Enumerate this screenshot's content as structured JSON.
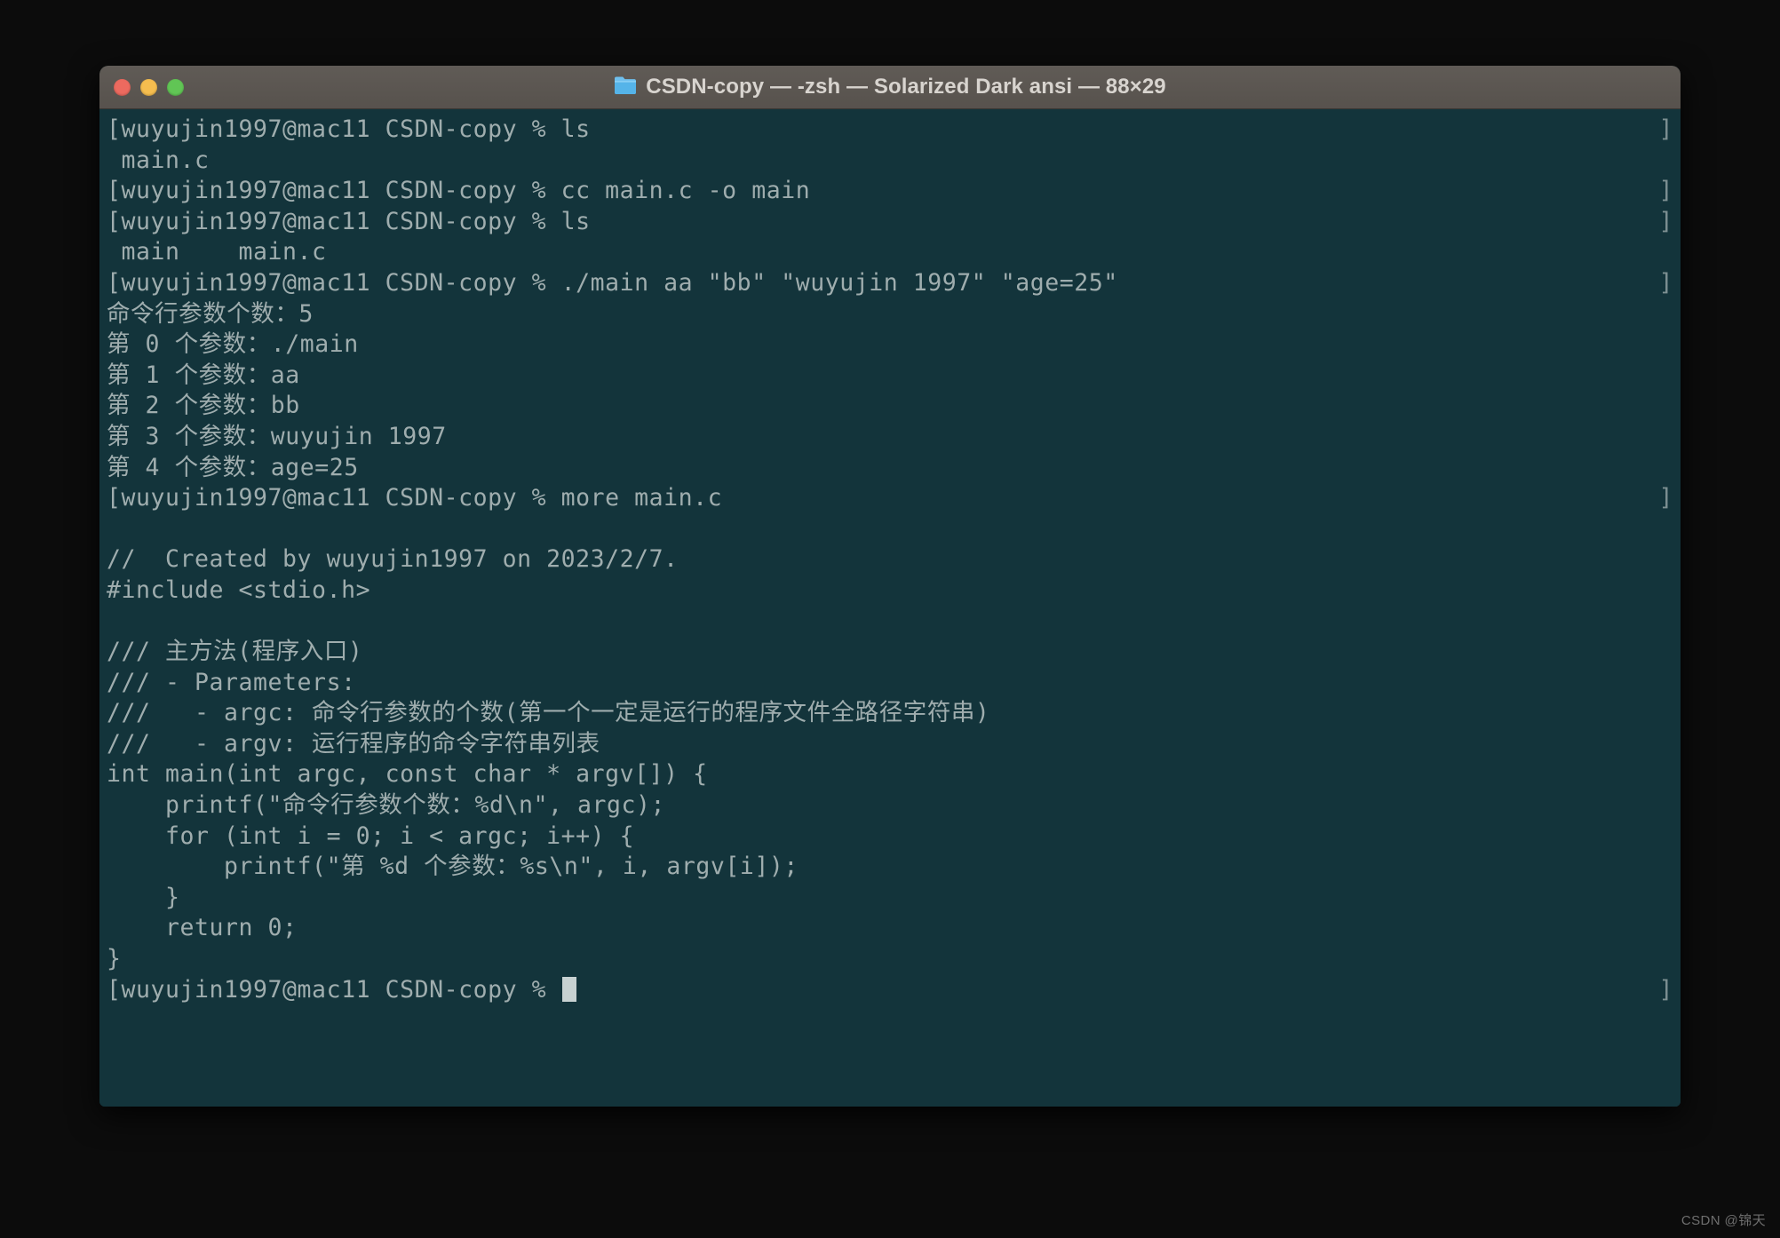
{
  "window": {
    "title": "CSDN-copy — -zsh — Solarized Dark ansi — 88×29",
    "folder_icon": "folder-icon",
    "traffic_lights": [
      {
        "name": "close-button",
        "label": "Close",
        "color": "#ec6a5f"
      },
      {
        "name": "minimize-button",
        "label": "Minimize",
        "color": "#f5bd4f"
      },
      {
        "name": "maximize-button",
        "label": "Zoom",
        "color": "#61c555"
      }
    ],
    "background_color": "#13343b",
    "titlebar_color": "#5a5550",
    "text_color": "#9fadae",
    "cursor_color": "#c8d2d2"
  },
  "terminal": {
    "prompt": "[wuyujin1997@mac11 CSDN-copy % ",
    "wrap_marker": "]",
    "lines": [
      {
        "type": "prompt",
        "text": "[wuyujin1997@mac11 CSDN-copy % ls",
        "wrap": true
      },
      {
        "type": "output",
        "text": " main.c",
        "wrap": false
      },
      {
        "type": "prompt",
        "text": "[wuyujin1997@mac11 CSDN-copy % cc main.c -o main",
        "wrap": true
      },
      {
        "type": "prompt",
        "text": "[wuyujin1997@mac11 CSDN-copy % ls",
        "wrap": true
      },
      {
        "type": "output",
        "text": " main    main.c",
        "wrap": false
      },
      {
        "type": "prompt",
        "text": "[wuyujin1997@mac11 CSDN-copy % ./main aa \"bb\" \"wuyujin 1997\" \"age=25\"",
        "wrap": true
      },
      {
        "type": "output",
        "text": "命令行参数个数：5",
        "wrap": false
      },
      {
        "type": "output",
        "text": "第 0 个参数：./main",
        "wrap": false
      },
      {
        "type": "output",
        "text": "第 1 个参数：aa",
        "wrap": false
      },
      {
        "type": "output",
        "text": "第 2 个参数：bb",
        "wrap": false
      },
      {
        "type": "output",
        "text": "第 3 个参数：wuyujin 1997",
        "wrap": false
      },
      {
        "type": "output",
        "text": "第 4 个参数：age=25",
        "wrap": false
      },
      {
        "type": "prompt",
        "text": "[wuyujin1997@mac11 CSDN-copy % more main.c",
        "wrap": true
      },
      {
        "type": "output",
        "text": "",
        "wrap": false
      },
      {
        "type": "output",
        "text": "//  Created by wuyujin1997 on 2023/2/7.",
        "wrap": false
      },
      {
        "type": "output",
        "text": "#include <stdio.h>",
        "wrap": false
      },
      {
        "type": "output",
        "text": "",
        "wrap": false
      },
      {
        "type": "output",
        "text": "/// 主方法(程序入口)",
        "wrap": false
      },
      {
        "type": "output",
        "text": "/// - Parameters:",
        "wrap": false
      },
      {
        "type": "output",
        "text": "///   - argc: 命令行参数的个数(第一个一定是运行的程序文件全路径字符串)",
        "wrap": false
      },
      {
        "type": "output",
        "text": "///   - argv: 运行程序的命令字符串列表",
        "wrap": false
      },
      {
        "type": "output",
        "text": "int main(int argc, const char * argv[]) {",
        "wrap": false
      },
      {
        "type": "output",
        "text": "    printf(\"命令行参数个数：%d\\n\", argc);",
        "wrap": false
      },
      {
        "type": "output",
        "text": "    for (int i = 0; i < argc; i++) {",
        "wrap": false
      },
      {
        "type": "output",
        "text": "        printf(\"第 %d 个参数：%s\\n\", i, argv[i]);",
        "wrap": false
      },
      {
        "type": "output",
        "text": "    }",
        "wrap": false
      },
      {
        "type": "output",
        "text": "    return 0;",
        "wrap": false
      },
      {
        "type": "output",
        "text": "}",
        "wrap": false
      },
      {
        "type": "cursor",
        "text": "[wuyujin1997@mac11 CSDN-copy % ",
        "wrap": true
      }
    ]
  },
  "watermark": {
    "text": "CSDN @锦天"
  }
}
